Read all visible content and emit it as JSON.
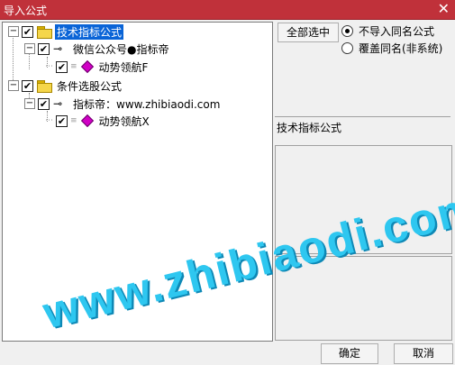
{
  "window": {
    "title": "导入公式",
    "close_glyph": "✕"
  },
  "tree": {
    "expander_glyph": "−",
    "check_glyph": "✔",
    "nodes": [
      {
        "label": "技术指标公式",
        "selected": true
      },
      {
        "label": "微信公众号●指标帝"
      },
      {
        "label": "动势领航F"
      },
      {
        "label": "条件选股公式"
      },
      {
        "label": "指标帝：www.zhibiaodi.com"
      },
      {
        "label": "动势领航X"
      }
    ]
  },
  "right_panel": {
    "select_all_label": "全部选中",
    "options": [
      {
        "label": "不导入同名公式",
        "selected": true
      },
      {
        "label": "覆盖同名(非系统)",
        "selected": false
      }
    ],
    "info_title": "技术指标公式"
  },
  "footer": {
    "ok_label": "确定",
    "cancel_label": "取消"
  },
  "watermark": {
    "text": "www.zhibiaodi.com",
    "color": "#2ec7f0"
  }
}
